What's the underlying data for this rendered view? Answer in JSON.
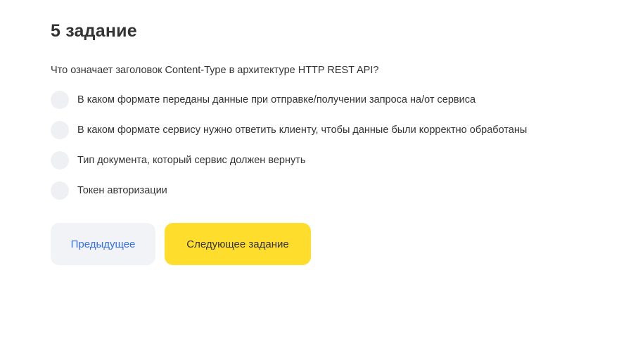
{
  "task": {
    "title": "5 задание",
    "question": "Что означает заголовок Content-Type в архитектуре HTTP REST API?",
    "options": [
      {
        "label": "В каком формате переданы данные при отправке/получении запроса на/от сервиса",
        "selected": false
      },
      {
        "label": "В каком формате сервису нужно ответить клиенту, чтобы данные были корректно обработаны",
        "selected": false
      },
      {
        "label": "Тип документа, который сервис должен вернуть",
        "selected": false
      },
      {
        "label": "Токен авторизации",
        "selected": false
      }
    ]
  },
  "buttons": {
    "prev_label": "Предыдущее",
    "next_label": "Следующее задание"
  },
  "colors": {
    "accent_yellow": "#ffdd2d",
    "link_blue": "#336fee",
    "secondary_bg": "#f1f3f7",
    "radio_bg": "#eef0f4",
    "text": "#333333"
  }
}
